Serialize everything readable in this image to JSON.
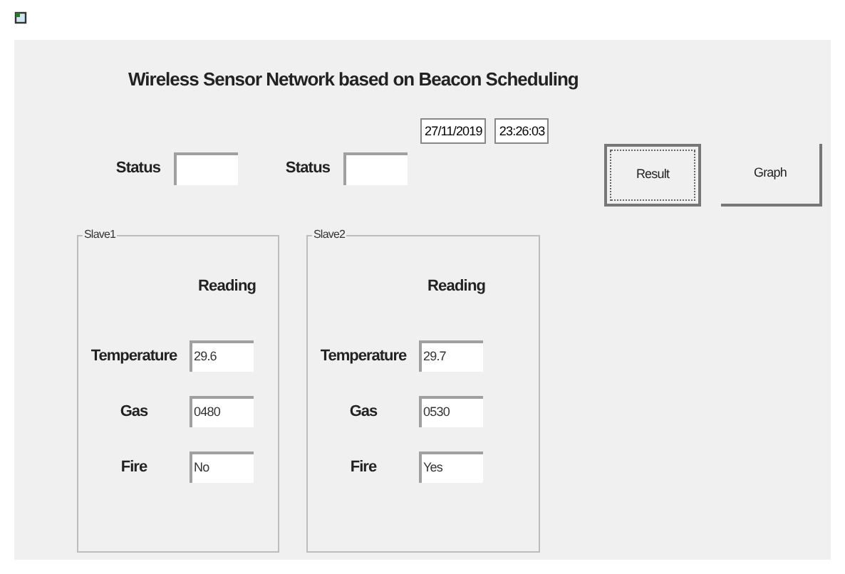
{
  "title": "Wireless Sensor Network based on Beacon Scheduling",
  "date": "27/11/2019",
  "time": "23:26:03",
  "status_fields": [
    {
      "label": "Status"
    },
    {
      "label": "Status"
    }
  ],
  "buttons": [
    {
      "label": "Result",
      "focused": true
    },
    {
      "label": "Graph",
      "focused": false
    }
  ],
  "slaves": [
    {
      "title": "Slave1",
      "heading": "Reading",
      "rows": [
        {
          "label": "Temperature",
          "value": "29.6"
        },
        {
          "label": "Gas",
          "value": "0480"
        },
        {
          "label": "Fire",
          "value": "No"
        }
      ]
    },
    {
      "title": "Slave2",
      "heading": "Reading",
      "rows": [
        {
          "label": "Temperature",
          "value": "29.7"
        },
        {
          "label": "Gas",
          "value": "0530"
        },
        {
          "label": "Fire",
          "value": "Yes"
        }
      ]
    }
  ]
}
